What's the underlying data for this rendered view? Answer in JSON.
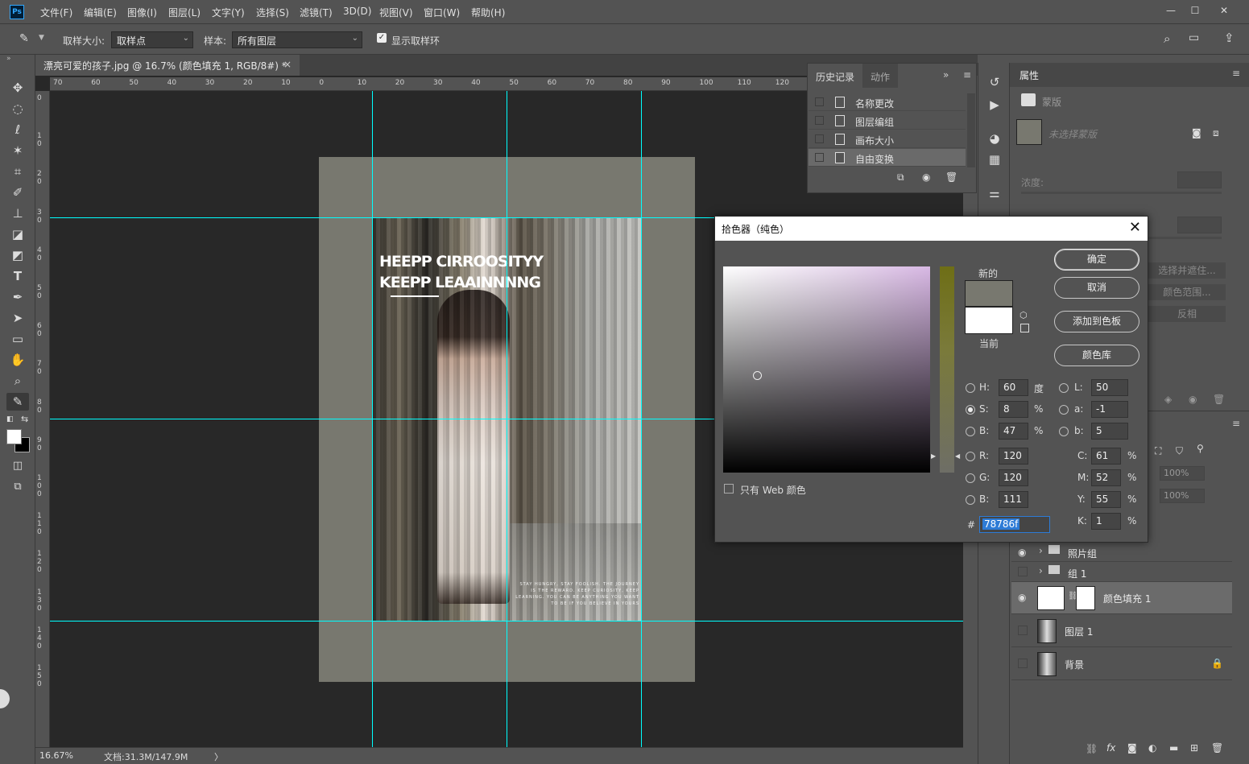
{
  "app": {
    "logo": "Ps"
  },
  "menu": [
    "文件(F)",
    "编辑(E)",
    "图像(I)",
    "图层(L)",
    "文字(Y)",
    "选择(S)",
    "滤镜(T)",
    "3D(D)",
    "视图(V)",
    "窗口(W)",
    "帮助(H)"
  ],
  "window_controls": {
    "minimize": "—",
    "maximize": "☐",
    "close": "✕"
  },
  "options": {
    "sample_size_label": "取样大小:",
    "sample_size_value": "取样点",
    "sample_label": "样本:",
    "sample_value": "所有图层",
    "show_ring_label": "显示取样环"
  },
  "document": {
    "tab_title": "漂亮可爱的孩子.jpg @ 16.7% (颜色填充 1, RGB/8#) *",
    "close": "×"
  },
  "ruler": {
    "h": [
      "70",
      "60",
      "50",
      "40",
      "30",
      "20",
      "10",
      "0",
      "10",
      "20",
      "30",
      "40",
      "50",
      "60",
      "70",
      "80",
      "90",
      "100",
      "110",
      "120"
    ],
    "v": [
      "0",
      "1 0",
      "2 0",
      "3 0",
      "4 0",
      "5 0",
      "6 0",
      "7 0",
      "8 0",
      "9 0",
      "1 0 0",
      "1 1 0",
      "1 2 0",
      "1 3 0",
      "1 4 0",
      "1 5 0"
    ]
  },
  "poster": {
    "title_line1": "HEEPP CIRROOSITYY",
    "title_line2": "KEEPP LEAAINNNNG",
    "small_text": "STAY HUNGRY, STAY FOOLISH. THE JOURNEY IS THE REWARD. KEEP CURIOSITY, KEEP LEARNING. YOU CAN BE ANYTHING YOU WANT TO BE IF YOU BELIEVE IN YOURS"
  },
  "status": {
    "zoom": "16.67%",
    "doc": "文档:31.3M/147.9M",
    "arrow": "〉"
  },
  "history": {
    "tab_history": "历史记录",
    "tab_actions": "动作",
    "items": [
      "名称更改",
      "图层编组",
      "画布大小",
      "自由变换"
    ]
  },
  "properties": {
    "title": "属性",
    "mask_label": "蒙版",
    "mask_state": "未选择蒙版",
    "density_label": "浓度:",
    "btn_refine": "选择并遮住...",
    "btn_color_range": "颜色范围...",
    "btn_invert": "反相"
  },
  "layers": {
    "opacity_value": "100%",
    "fill_value": "100%",
    "items": [
      {
        "name": "照片组",
        "type": "group",
        "visible": true
      },
      {
        "name": "组 1",
        "type": "group",
        "visible": false
      },
      {
        "name": "颜色填充 1",
        "type": "fill",
        "visible": true
      },
      {
        "name": "图层 1",
        "type": "layer",
        "visible": false
      },
      {
        "name": "背景",
        "type": "layer",
        "visible": false
      }
    ]
  },
  "picker": {
    "title": "拾色器（纯色）",
    "close": "✕",
    "new_label": "新的",
    "current_label": "当前",
    "new_color": "#78786f",
    "current_color": "#ffffff",
    "buttons": {
      "ok": "确定",
      "cancel": "取消",
      "add_swatch": "添加到色板",
      "libraries": "颜色库"
    },
    "web_only": "只有 Web 颜色",
    "hsb": {
      "H": "60",
      "S": "8",
      "B": "47",
      "h_unit": "度",
      "s_unit": "%",
      "b_unit": "%"
    },
    "rgb": {
      "R": "120",
      "G": "120",
      "B": "111"
    },
    "lab": {
      "L": "50",
      "a": "-1",
      "b": "5"
    },
    "cmyk": {
      "C": "61",
      "M": "52",
      "Y": "55",
      "K": "1",
      "unit": "%"
    },
    "hex_label": "#",
    "hex": "78786f",
    "selected_mode": "S"
  }
}
